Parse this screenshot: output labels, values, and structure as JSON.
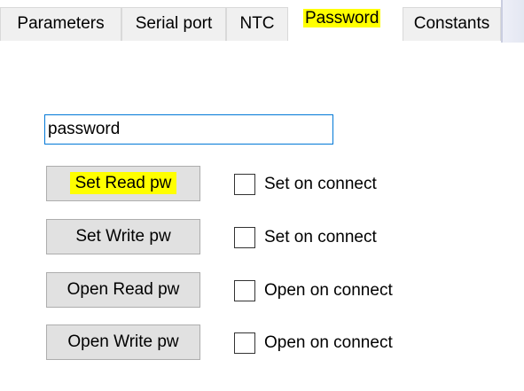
{
  "tabs": {
    "parameters": "Parameters",
    "serial_port": "Serial port",
    "ntc": "NTC",
    "password": "Password",
    "constants": "Constants",
    "active": "Password"
  },
  "password_field": {
    "value": "password"
  },
  "buttons": {
    "set_read": "Set Read pw",
    "set_write": "Set Write pw",
    "open_read": "Open Read pw",
    "open_write": "Open Write pw"
  },
  "checkboxes": {
    "set_read": {
      "label": "Set on connect",
      "checked": false
    },
    "set_write": {
      "label": "Set on connect",
      "checked": false
    },
    "open_read": {
      "label": "Open on connect",
      "checked": false
    },
    "open_write": {
      "label": "Open on connect",
      "checked": false
    }
  },
  "colors": {
    "highlight": "#ffff00",
    "input_border_focus": "#0078d7",
    "button_face": "#e1e1e1",
    "tab_inactive": "#f0f0f0"
  }
}
